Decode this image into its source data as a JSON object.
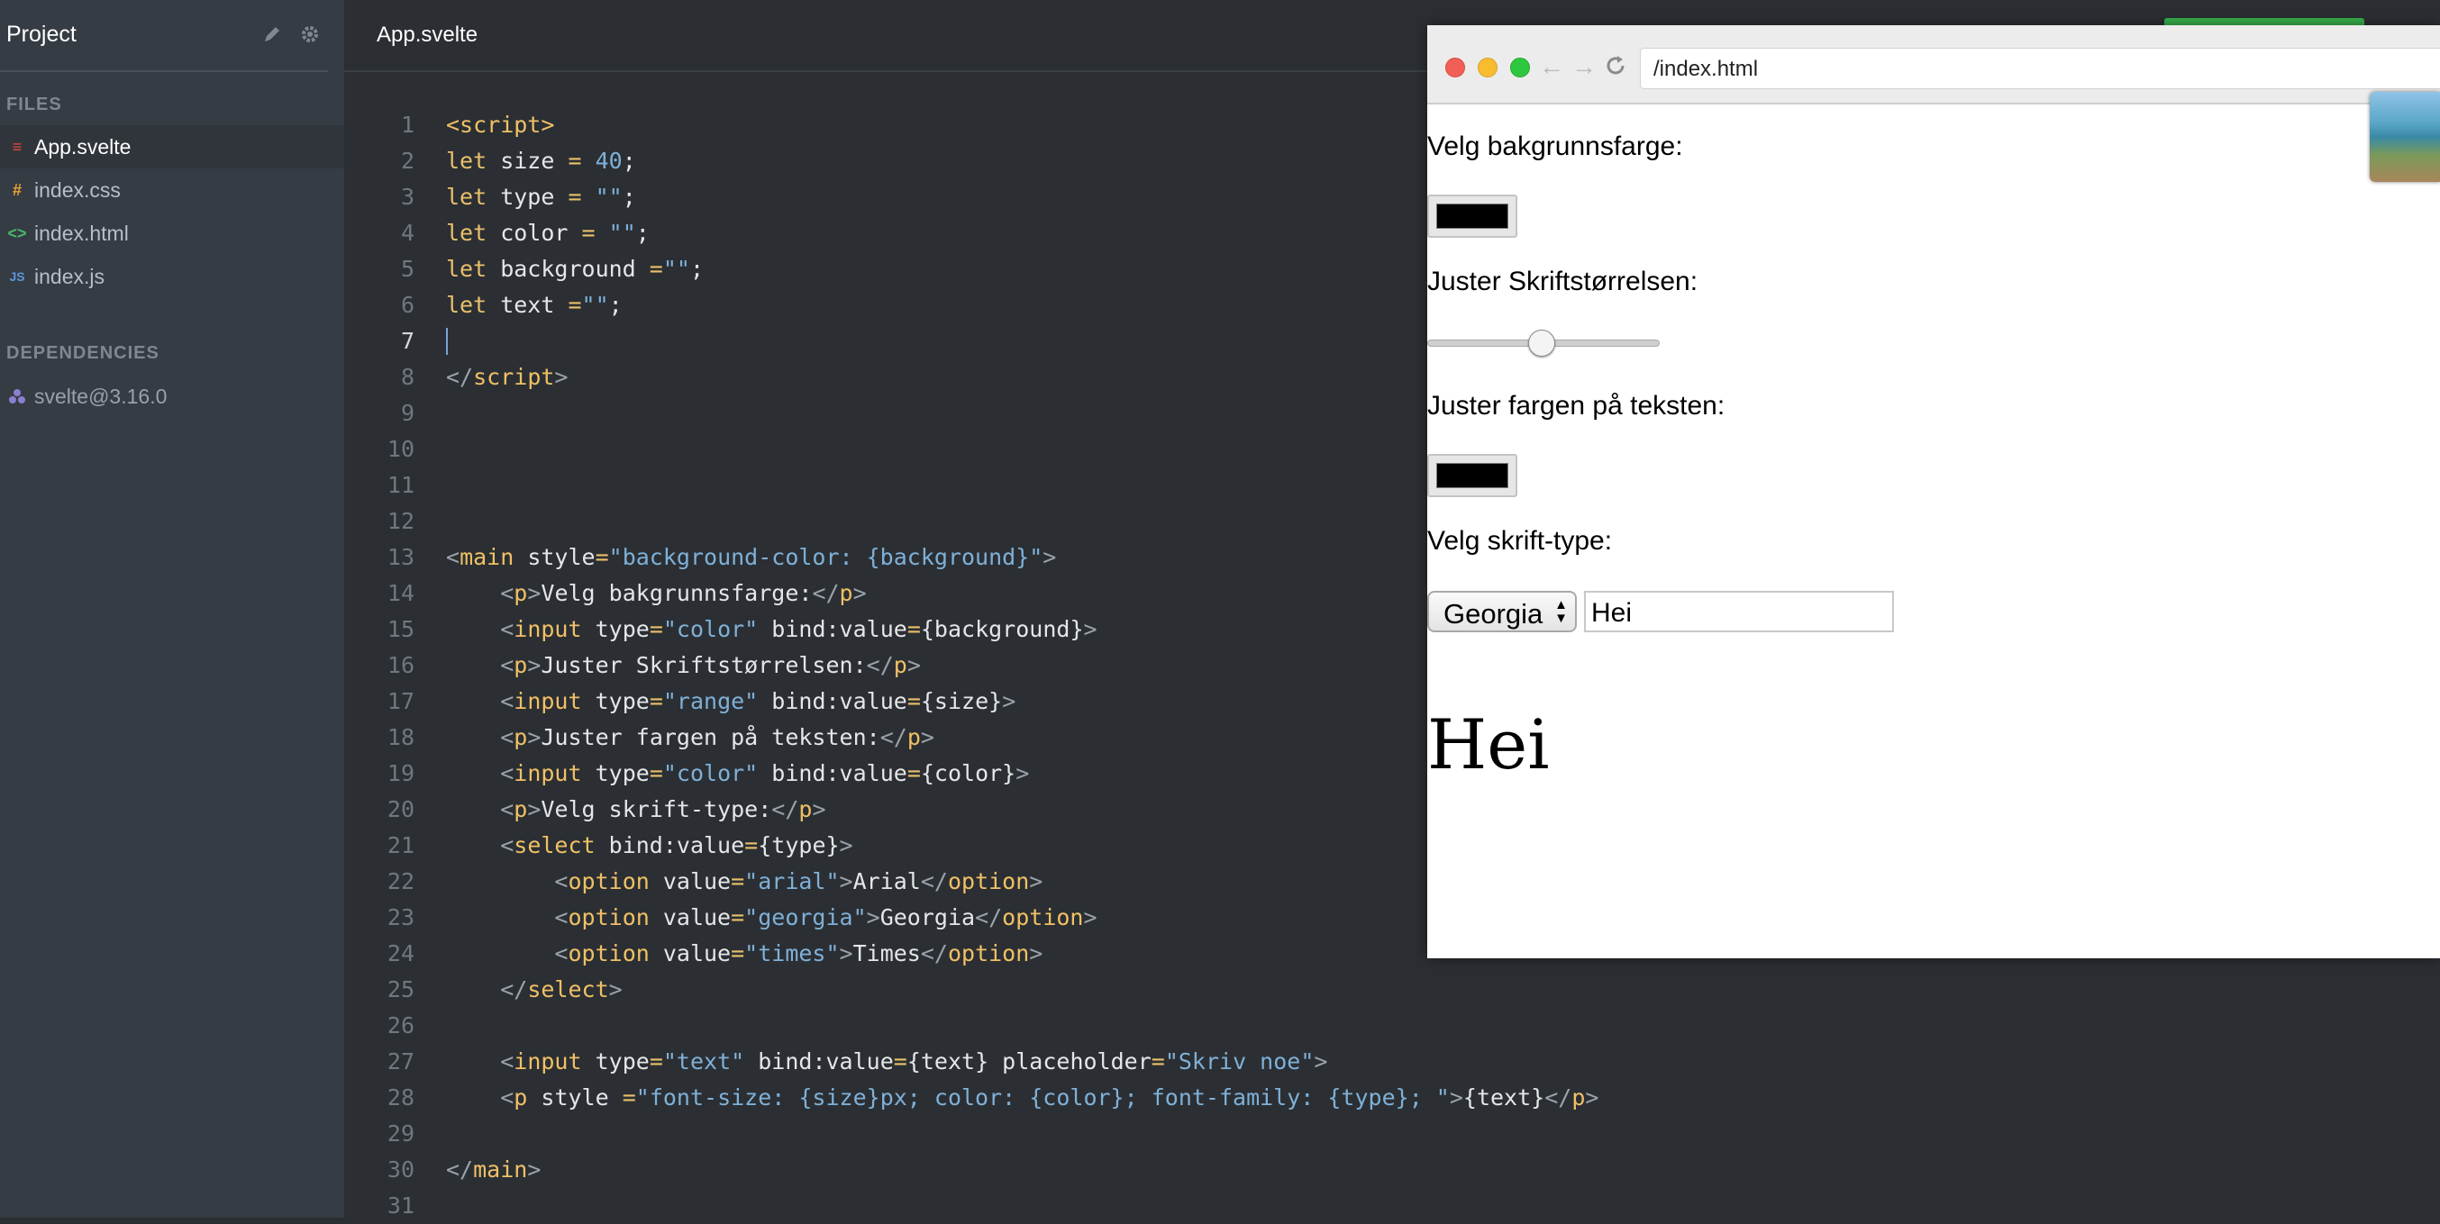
{
  "sidebar": {
    "project_title": "Project",
    "files_label": "FILES",
    "files": [
      {
        "name": "App.svelte",
        "icon": "svelte-file-icon",
        "glyph": "≡",
        "color": "#e0483a",
        "active": true
      },
      {
        "name": "index.css",
        "icon": "css-file-icon",
        "glyph": "#",
        "color": "#e8a23a",
        "active": false
      },
      {
        "name": "index.html",
        "icon": "html-file-icon",
        "glyph": "<>",
        "color": "#46b96a",
        "active": false
      },
      {
        "name": "index.js",
        "icon": "js-file-icon",
        "glyph": "JS",
        "color": "#5a96e0",
        "active": false
      }
    ],
    "dependencies_label": "DEPENDENCIES",
    "dependencies": [
      {
        "name": "svelte@3.16.0",
        "icon": "package-icon"
      }
    ]
  },
  "editor": {
    "tab_title": "App.svelte",
    "current_line": 7,
    "lines": [
      [
        [
          "tag",
          "<script>"
        ]
      ],
      [
        [
          "kw",
          "let"
        ],
        [
          "txt",
          " size "
        ],
        [
          "op",
          "="
        ],
        [
          "txt",
          " "
        ],
        [
          "num",
          "40"
        ],
        [
          "txt",
          ";"
        ]
      ],
      [
        [
          "kw",
          "let"
        ],
        [
          "txt",
          " type "
        ],
        [
          "op",
          "="
        ],
        [
          "txt",
          " "
        ],
        [
          "str",
          "\"\""
        ],
        [
          "txt",
          ";"
        ]
      ],
      [
        [
          "kw",
          "let"
        ],
        [
          "txt",
          " color "
        ],
        [
          "op",
          "="
        ],
        [
          "txt",
          " "
        ],
        [
          "str",
          "\"\""
        ],
        [
          "txt",
          ";"
        ]
      ],
      [
        [
          "kw",
          "let"
        ],
        [
          "txt",
          " background "
        ],
        [
          "op",
          "="
        ],
        [
          "str",
          "\"\""
        ],
        [
          "txt",
          ";"
        ]
      ],
      [
        [
          "kw",
          "let"
        ],
        [
          "txt",
          " text "
        ],
        [
          "op",
          "="
        ],
        [
          "str",
          "\"\""
        ],
        [
          "txt",
          ";"
        ]
      ],
      [],
      [
        [
          "tagc",
          "</"
        ],
        [
          "tag",
          "script"
        ],
        [
          "tagc",
          ">"
        ]
      ],
      [],
      [],
      [],
      [],
      [
        [
          "tagc",
          "<"
        ],
        [
          "tag",
          "main"
        ],
        [
          "txt",
          " style"
        ],
        [
          "op",
          "="
        ],
        [
          "str",
          "\"background-color: {background}\""
        ],
        [
          "tagc",
          ">"
        ]
      ],
      [
        [
          "txt",
          "    "
        ],
        [
          "tagc",
          "<"
        ],
        [
          "tag",
          "p"
        ],
        [
          "tagc",
          ">"
        ],
        [
          "txt",
          "Velg bakgrunnsfarge:"
        ],
        [
          "tagc",
          "</"
        ],
        [
          "tag",
          "p"
        ],
        [
          "tagc",
          ">"
        ]
      ],
      [
        [
          "txt",
          "    "
        ],
        [
          "tagc",
          "<"
        ],
        [
          "tag",
          "input"
        ],
        [
          "txt",
          " type"
        ],
        [
          "op",
          "="
        ],
        [
          "str",
          "\"color\""
        ],
        [
          "txt",
          " bind:value"
        ],
        [
          "op",
          "="
        ],
        [
          "txt",
          "{background}"
        ],
        [
          "tagc",
          ">"
        ]
      ],
      [
        [
          "txt",
          "    "
        ],
        [
          "tagc",
          "<"
        ],
        [
          "tag",
          "p"
        ],
        [
          "tagc",
          ">"
        ],
        [
          "txt",
          "Juster Skriftstørrelsen:"
        ],
        [
          "tagc",
          "</"
        ],
        [
          "tag",
          "p"
        ],
        [
          "tagc",
          ">"
        ]
      ],
      [
        [
          "txt",
          "    "
        ],
        [
          "tagc",
          "<"
        ],
        [
          "tag",
          "input"
        ],
        [
          "txt",
          " type"
        ],
        [
          "op",
          "="
        ],
        [
          "str",
          "\"range\""
        ],
        [
          "txt",
          " bind:value"
        ],
        [
          "op",
          "="
        ],
        [
          "txt",
          "{size}"
        ],
        [
          "tagc",
          ">"
        ]
      ],
      [
        [
          "txt",
          "    "
        ],
        [
          "tagc",
          "<"
        ],
        [
          "tag",
          "p"
        ],
        [
          "tagc",
          ">"
        ],
        [
          "txt",
          "Juster fargen på teksten:"
        ],
        [
          "tagc",
          "</"
        ],
        [
          "tag",
          "p"
        ],
        [
          "tagc",
          ">"
        ]
      ],
      [
        [
          "txt",
          "    "
        ],
        [
          "tagc",
          "<"
        ],
        [
          "tag",
          "input"
        ],
        [
          "txt",
          " type"
        ],
        [
          "op",
          "="
        ],
        [
          "str",
          "\"color\""
        ],
        [
          "txt",
          " bind:value"
        ],
        [
          "op",
          "="
        ],
        [
          "txt",
          "{color}"
        ],
        [
          "tagc",
          ">"
        ]
      ],
      [
        [
          "txt",
          "    "
        ],
        [
          "tagc",
          "<"
        ],
        [
          "tag",
          "p"
        ],
        [
          "tagc",
          ">"
        ],
        [
          "txt",
          "Velg skrift-type:"
        ],
        [
          "tagc",
          "</"
        ],
        [
          "tag",
          "p"
        ],
        [
          "tagc",
          ">"
        ]
      ],
      [
        [
          "txt",
          "    "
        ],
        [
          "tagc",
          "<"
        ],
        [
          "tag",
          "select"
        ],
        [
          "txt",
          " bind:value"
        ],
        [
          "op",
          "="
        ],
        [
          "txt",
          "{type}"
        ],
        [
          "tagc",
          ">"
        ]
      ],
      [
        [
          "txt",
          "        "
        ],
        [
          "tagc",
          "<"
        ],
        [
          "tag",
          "option"
        ],
        [
          "txt",
          " value"
        ],
        [
          "op",
          "="
        ],
        [
          "str",
          "\"arial\""
        ],
        [
          "tagc",
          ">"
        ],
        [
          "txt",
          "Arial"
        ],
        [
          "tagc",
          "</"
        ],
        [
          "tag",
          "option"
        ],
        [
          "tagc",
          ">"
        ]
      ],
      [
        [
          "txt",
          "        "
        ],
        [
          "tagc",
          "<"
        ],
        [
          "tag",
          "option"
        ],
        [
          "txt",
          " value"
        ],
        [
          "op",
          "="
        ],
        [
          "str",
          "\"georgia\""
        ],
        [
          "tagc",
          ">"
        ],
        [
          "txt",
          "Georgia"
        ],
        [
          "tagc",
          "</"
        ],
        [
          "tag",
          "option"
        ],
        [
          "tagc",
          ">"
        ]
      ],
      [
        [
          "txt",
          "        "
        ],
        [
          "tagc",
          "<"
        ],
        [
          "tag",
          "option"
        ],
        [
          "txt",
          " value"
        ],
        [
          "op",
          "="
        ],
        [
          "str",
          "\"times\""
        ],
        [
          "tagc",
          ">"
        ],
        [
          "txt",
          "Times"
        ],
        [
          "tagc",
          "</"
        ],
        [
          "tag",
          "option"
        ],
        [
          "tagc",
          ">"
        ]
      ],
      [
        [
          "txt",
          "    "
        ],
        [
          "tagc",
          "</"
        ],
        [
          "tag",
          "select"
        ],
        [
          "tagc",
          ">"
        ]
      ],
      [],
      [
        [
          "txt",
          "    "
        ],
        [
          "tagc",
          "<"
        ],
        [
          "tag",
          "input"
        ],
        [
          "txt",
          " type"
        ],
        [
          "op",
          "="
        ],
        [
          "str",
          "\"text\""
        ],
        [
          "txt",
          " bind:value"
        ],
        [
          "op",
          "="
        ],
        [
          "txt",
          "{text} placeholder"
        ],
        [
          "op",
          "="
        ],
        [
          "str",
          "\"Skriv noe\""
        ],
        [
          "tagc",
          ">"
        ]
      ],
      [
        [
          "txt",
          "    "
        ],
        [
          "tagc",
          "<"
        ],
        [
          "tag",
          "p"
        ],
        [
          "txt",
          " style "
        ],
        [
          "op",
          "="
        ],
        [
          "str",
          "\"font-size: {size}px; color: {color}; font-family: {type}; \""
        ],
        [
          "tagc",
          ">"
        ],
        [
          "txt",
          "{text}"
        ],
        [
          "tagc",
          "</"
        ],
        [
          "tag",
          "p"
        ],
        [
          "tagc",
          ">"
        ]
      ],
      [],
      [
        [
          "tagc",
          "</"
        ],
        [
          "tag",
          "main"
        ],
        [
          "tagc",
          ">"
        ]
      ],
      []
    ]
  },
  "preview": {
    "url": "/index.html",
    "label_background": "Velg bakgrunnsfarge:",
    "background_color_value": "#000000",
    "label_size": "Juster Skriftstørrelsen:",
    "size_value": 40,
    "label_color": "Juster fargen på teksten:",
    "text_color_value": "#000000",
    "label_font": "Velg skrift-type:",
    "font_selected": "Georgia",
    "text_input_value": "Hei",
    "output_text": "Hei"
  },
  "colors": {
    "sidebar_bg": "#363c43",
    "editor_bg": "#2b2f33",
    "accent_green": "#37b24d"
  }
}
